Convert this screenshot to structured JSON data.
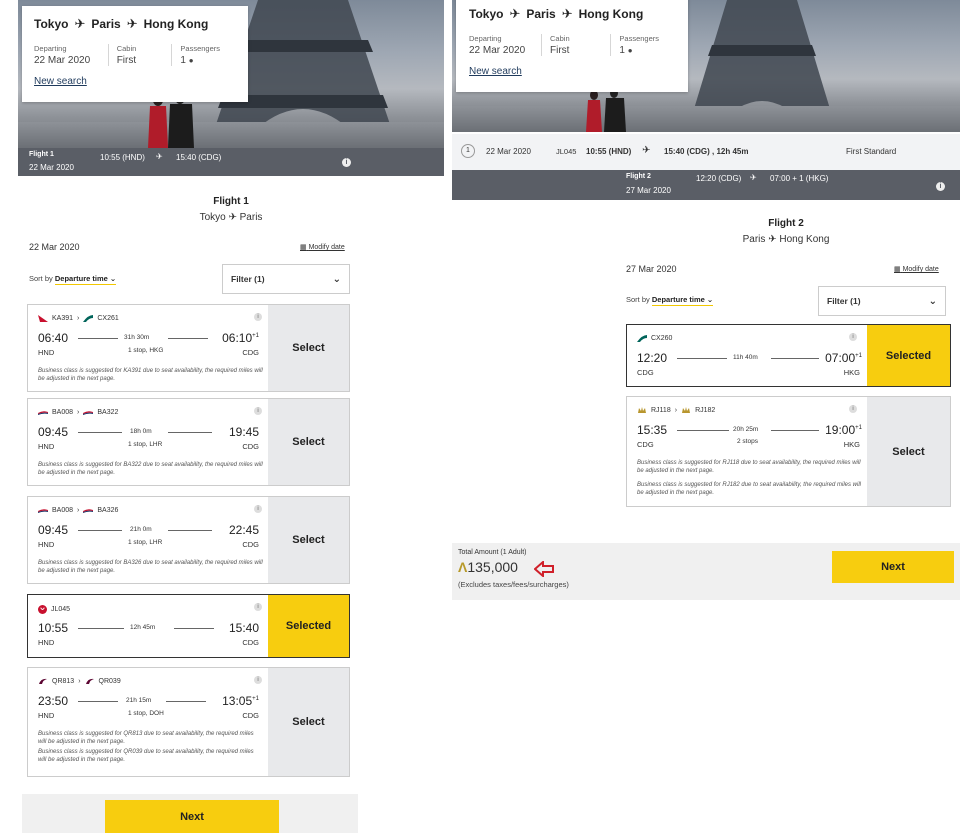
{
  "search_summary": {
    "route": [
      "Tokyo",
      "Paris",
      "Hong Kong"
    ],
    "departing_label": "Departing",
    "departing_value": "22 Mar 2020",
    "cabin_label": "Cabin",
    "cabin_value": "First",
    "passengers_label": "Passengers",
    "passengers_value": "1",
    "new_search": "New search"
  },
  "left": {
    "flight_bar": {
      "title": "Flight 1",
      "date": "22 Mar 2020",
      "times": "10:55 (HND)",
      "arrive": "15:40 (CDG)"
    },
    "heading": {
      "title": "Flight 1",
      "from": "Tokyo",
      "to": "Paris"
    },
    "date": "22 Mar 2020",
    "modify_date": "Modify date",
    "sort_label": "Sort by",
    "sort_value": "Departure time",
    "filter": "Filter (1)",
    "flights": [
      {
        "carriers": [
          "KA391",
          "CX261"
        ],
        "dep": "06:40",
        "arr": "06:10",
        "arr_sup": "+1",
        "duration": "31h 30m",
        "stops": "1 stop, HKG",
        "from": "HND",
        "to": "CDG",
        "note": "Business class is suggested for KA391 due to seat availability, the required miles will be adjusted in the next page.",
        "button": "Select"
      },
      {
        "carriers": [
          "BA008",
          "BA322"
        ],
        "dep": "09:45",
        "arr": "19:45",
        "arr_sup": "",
        "duration": "18h 0m",
        "stops": "1 stop, LHR",
        "from": "HND",
        "to": "CDG",
        "note": "Business class is suggested for BA322 due to seat availability, the required miles will be adjusted in the next page.",
        "button": "Select"
      },
      {
        "carriers": [
          "BA008",
          "BA326"
        ],
        "dep": "09:45",
        "arr": "22:45",
        "arr_sup": "",
        "duration": "21h 0m",
        "stops": "1 stop, LHR",
        "from": "HND",
        "to": "CDG",
        "note": "Business class is suggested for BA326 due to seat availability, the required miles will be adjusted in the next page.",
        "button": "Select"
      },
      {
        "carriers": [
          "JL045"
        ],
        "dep": "10:55",
        "arr": "15:40",
        "arr_sup": "",
        "duration": "12h 45m",
        "stops": "",
        "from": "HND",
        "to": "CDG",
        "note": "",
        "button": "Selected"
      },
      {
        "carriers": [
          "QR813",
          "QR039"
        ],
        "dep": "23:50",
        "arr": "13:05",
        "arr_sup": "+1",
        "duration": "21h 15m",
        "stops": "1 stop, DOH",
        "from": "HND",
        "to": "CDG",
        "note": "Business class is suggested for QR813 due to seat availability, the required miles will be adjusted in the next page.",
        "note2": "Business class is suggested for QR039 due to seat availability, the required miles will be adjusted in the next page.",
        "button": "Select"
      }
    ],
    "next": "Next"
  },
  "right": {
    "selected_row": {
      "num": "1",
      "date": "22 Mar 2020",
      "flight": "JL045",
      "dep": "10:55 (HND)",
      "arr": "15:40 (CDG) , 12h 45m",
      "cabin": "First Standard"
    },
    "flight_bar": {
      "title": "Flight 2",
      "date": "27 Mar 2020",
      "times": "12:20 (CDG)",
      "arrive": "07:00 + 1 (HKG)"
    },
    "heading": {
      "title": "Flight 2",
      "from": "Paris",
      "to": "Hong Kong"
    },
    "date": "27 Mar 2020",
    "modify_date": "Modify date",
    "sort_label": "Sort by",
    "sort_value": "Departure time",
    "filter": "Filter (1)",
    "flights": [
      {
        "carriers": [
          "CX260"
        ],
        "dep": "12:20",
        "arr": "07:00",
        "arr_sup": "+1",
        "duration": "11h 40m",
        "stops": "",
        "from": "CDG",
        "to": "HKG",
        "note": "",
        "button": "Selected"
      },
      {
        "carriers": [
          "RJ118",
          "RJ182"
        ],
        "dep": "15:35",
        "arr": "19:00",
        "arr_sup": "+1",
        "duration": "20h 25m",
        "stops": "2 stops",
        "from": "CDG",
        "to": "HKG",
        "note": "Business class is suggested for RJ118 due to seat availability, the required miles will be adjusted in the next page.",
        "note2": "Business class is suggested for RJ182 due to seat availability, the required miles will be adjusted in the next page.",
        "button": "Select"
      }
    ],
    "total": {
      "label": "Total Amount (1 Adult)",
      "amount": "135,000",
      "excludes": "(Excludes taxes/fees/surcharges)"
    },
    "next": "Next"
  },
  "colors": {
    "accent_yellow": "#f7cd0f",
    "bar_grey": "#5a5e66",
    "arrow_red": "#d0202a"
  }
}
